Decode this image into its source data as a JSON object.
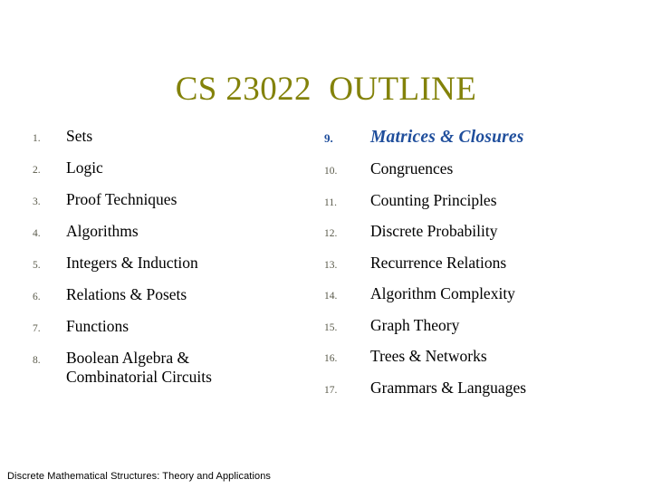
{
  "slide": {
    "title": "CS 23022  OUTLINE",
    "title_color": "#83820a",
    "background_color": "#ffffff",
    "accent_color": "#1f4e9c",
    "number_color": "#595949",
    "body_color": "#000000"
  },
  "outline": {
    "left_column": [
      {
        "number": "1.",
        "label": "Sets"
      },
      {
        "number": "2.",
        "label": "Logic"
      },
      {
        "number": "3.",
        "label": "Proof Techniques"
      },
      {
        "number": "4.",
        "label": "Algorithms"
      },
      {
        "number": "5.",
        "label": "Integers & Induction"
      },
      {
        "number": "6.",
        "label": "Relations & Posets"
      },
      {
        "number": "7.",
        "label": "Functions"
      },
      {
        "number": "8.",
        "label": "Boolean Algebra &\nCombinatorial Circuits"
      }
    ],
    "right_column": [
      {
        "number": "9.",
        "label": "Matrices & Closures"
      },
      {
        "number": "10.",
        "label": "Congruences"
      },
      {
        "number": "11.",
        "label": "Counting Principles"
      },
      {
        "number": "12.",
        "label": "Discrete Probability"
      },
      {
        "number": "13.",
        "label": "Recurrence Relations"
      },
      {
        "number": "14.",
        "label": "Algorithm Complexity"
      },
      {
        "number": "15.",
        "label": "Graph Theory"
      },
      {
        "number": "16.",
        "label": "Trees & Networks"
      },
      {
        "number": "17.",
        "label": "Grammars & Languages"
      }
    ]
  },
  "footer": {
    "text": "Discrete Mathematical Structures: Theory and Applications"
  }
}
